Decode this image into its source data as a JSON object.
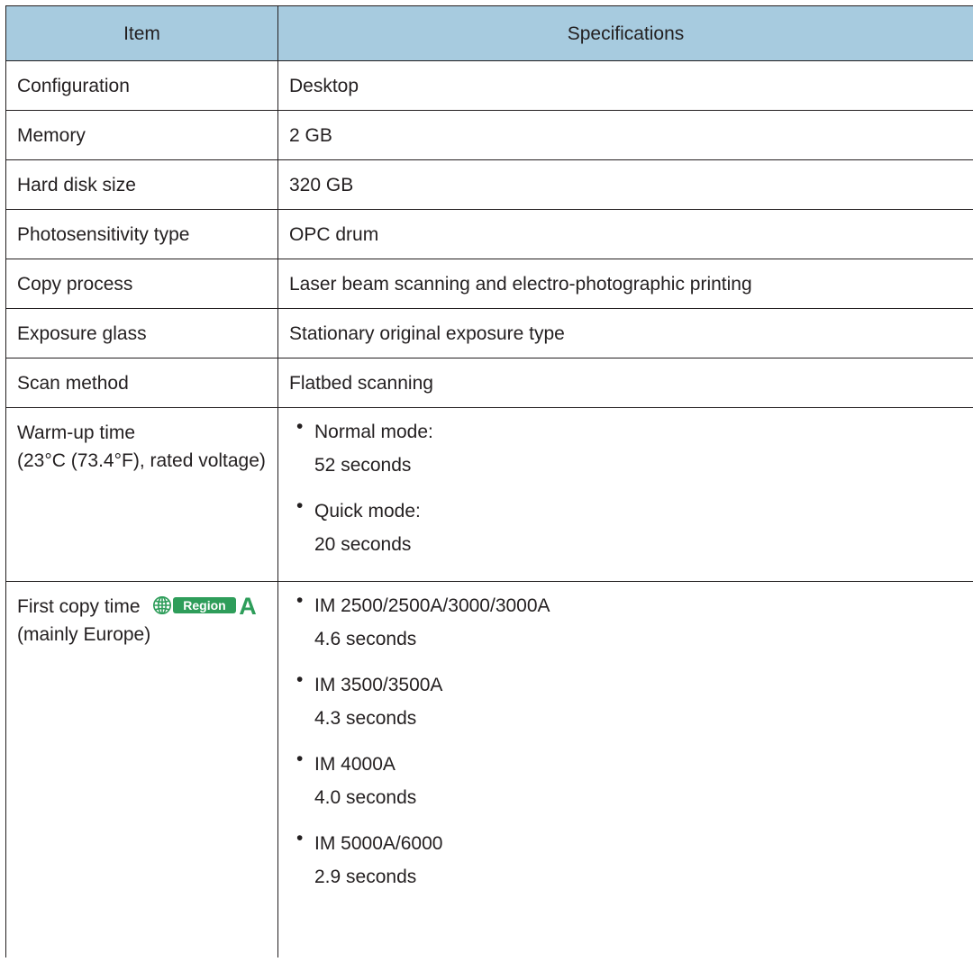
{
  "table": {
    "headers": [
      "Item",
      "Specifications"
    ],
    "rows": [
      {
        "item": "Configuration",
        "spec": "Desktop"
      },
      {
        "item": "Memory",
        "spec": "2 GB"
      },
      {
        "item": "Hard disk size",
        "spec": "320 GB"
      },
      {
        "item": "Photosensitivity type",
        "spec": "OPC drum"
      },
      {
        "item": "Copy process",
        "spec": "Laser beam scanning and electro-photographic printing"
      },
      {
        "item": "Exposure glass",
        "spec": "Stationary original exposure type"
      },
      {
        "item": "Scan method",
        "spec": "Flatbed scanning"
      }
    ],
    "warmup": {
      "item_line1": "Warm-up time",
      "item_line2": "(23°C (73.4°F), rated voltage)",
      "entries": [
        {
          "mode": "Normal mode:",
          "value": "52 seconds"
        },
        {
          "mode": "Quick mode:",
          "value": "20 seconds"
        }
      ]
    },
    "first_copy": {
      "item_label": "First copy time",
      "region_word": "Region",
      "region_letter": "A",
      "region_note": "(mainly Europe)",
      "entries": [
        {
          "model": "IM 2500/2500A/3000/3000A",
          "value": "4.6 seconds"
        },
        {
          "model": "IM 3500/3500A",
          "value": "4.3 seconds"
        },
        {
          "model": "IM 4000A",
          "value": "4.0 seconds"
        },
        {
          "model": "IM 5000A/6000",
          "value": "2.9 seconds"
        }
      ]
    }
  },
  "colors": {
    "header_bg": "#a7cbdf",
    "border": "#231f20",
    "region_green": "#2e9d5a"
  },
  "icons": {
    "region": "globe-icon"
  }
}
